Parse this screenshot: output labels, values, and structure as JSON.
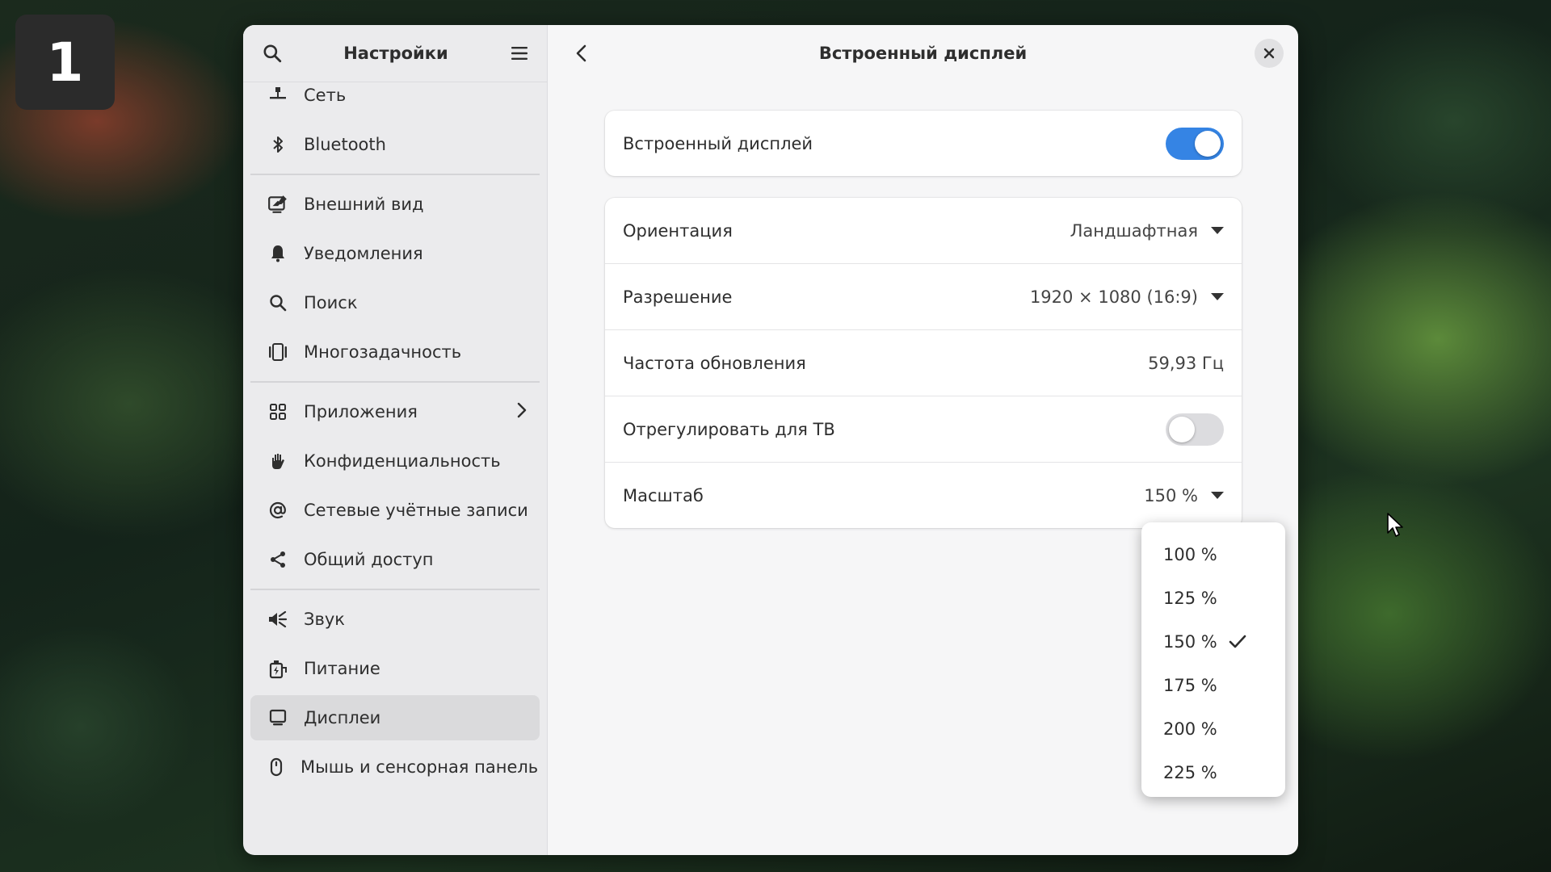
{
  "workspace": {
    "number": "1"
  },
  "sidebar": {
    "title": "Настройки",
    "items": [
      {
        "label": "Сеть",
        "icon": "network-icon"
      },
      {
        "label": "Bluetooth",
        "icon": "bluetooth-icon"
      },
      {
        "label": "Внешний вид",
        "icon": "appearance-icon"
      },
      {
        "label": "Уведомления",
        "icon": "bell-icon"
      },
      {
        "label": "Поиск",
        "icon": "search-icon"
      },
      {
        "label": "Многозадачность",
        "icon": "multitasking-icon"
      },
      {
        "label": "Приложения",
        "icon": "apps-grid-icon"
      },
      {
        "label": "Конфиденциальность",
        "icon": "hand-icon"
      },
      {
        "label": "Сетевые учётные записи",
        "icon": "at-icon"
      },
      {
        "label": "Общий доступ",
        "icon": "share-icon"
      },
      {
        "label": "Звук",
        "icon": "speaker-icon"
      },
      {
        "label": "Питание",
        "icon": "power-icon"
      },
      {
        "label": "Дисплеи",
        "icon": "display-icon"
      },
      {
        "label": "Мышь и сенсорная панель",
        "icon": "mouse-icon"
      }
    ],
    "selected": "Дисплеи"
  },
  "content": {
    "title": "Встроенный дисплей",
    "display_toggle": {
      "label": "Встроенный дисплей",
      "on": true
    },
    "rows": {
      "orientation": {
        "label": "Ориентация",
        "value": "Ландшафтная"
      },
      "resolution": {
        "label": "Разрешение",
        "value": "1920 × 1080 (16:9)"
      },
      "refresh": {
        "label": "Частота обновления",
        "value": "59,93 Гц"
      },
      "tv": {
        "label": "Отрегулировать для ТВ",
        "on": false
      },
      "scale": {
        "label": "Масштаб",
        "value": "150 %"
      }
    }
  },
  "scale_popover": {
    "options": [
      "100 %",
      "125 %",
      "150 %",
      "175 %",
      "200 %",
      "225 %"
    ],
    "selected": "150 %"
  },
  "colors": {
    "accent": "#3584e4",
    "sidebar_bg": "#ebebed",
    "content_bg": "#f6f6f7"
  }
}
